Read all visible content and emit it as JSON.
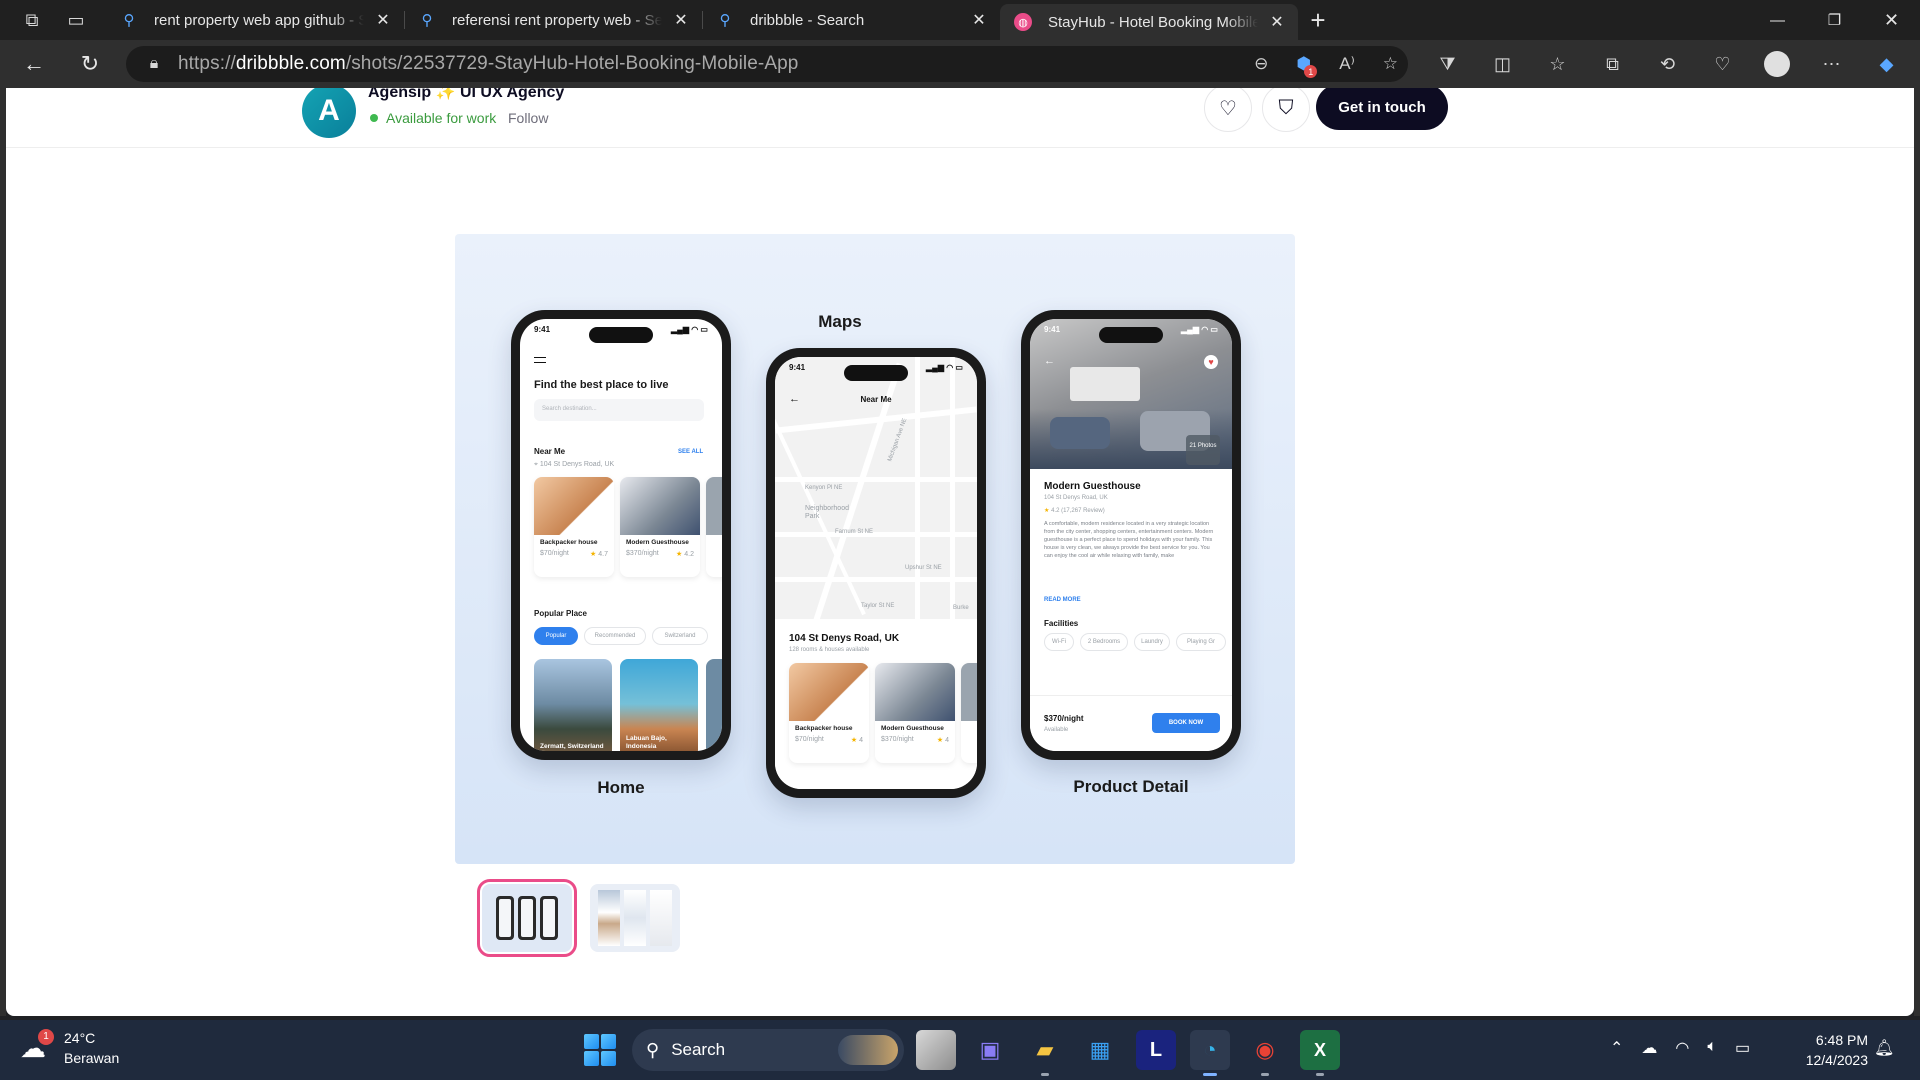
{
  "browser": {
    "tabs": [
      {
        "title": "rent property web app github - S",
        "icon": "search-icon",
        "active": false
      },
      {
        "title": "referensi rent property web - Sea",
        "icon": "search-icon",
        "active": false
      },
      {
        "title": "dribbble - Search",
        "icon": "search-icon",
        "active": false
      },
      {
        "title": "StayHub - Hotel Booking Mobile",
        "icon": "dribbble-icon",
        "active": true
      }
    ],
    "url_prefix": "https://",
    "url_domain": "dribbble.com",
    "url_path": "/shots/22537729-StayHub-Hotel-Booking-Mobile-App",
    "extension_badge": "1"
  },
  "shot": {
    "agency_name": "Agensip",
    "agency_suffix": "UI UX Agency",
    "availability": "Available for work",
    "follow_label": "Follow",
    "cta_label": "Get in touch"
  },
  "mockup": {
    "labels": {
      "home": "Home",
      "maps": "Maps",
      "detail": "Product Detail"
    },
    "status_time": "9:41",
    "home": {
      "title": "Find the best place to live",
      "search_placeholder": "Search destination...",
      "near_me": "Near Me",
      "see_all": "SEE ALL",
      "location": "104 St Denys Road, UK",
      "cards": [
        {
          "name": "Backpacker house",
          "price": "$70/night",
          "rating": "4.7"
        },
        {
          "name": "Modern Guesthouse",
          "price": "$370/night",
          "rating": "4.2"
        }
      ],
      "popular": "Popular Place",
      "chips": [
        "Popular",
        "Recommended",
        "Switzerland"
      ],
      "places": [
        "Zermatt, Switzerland",
        "Labuan Bajo, Indonesia"
      ]
    },
    "maps": {
      "header": "Near Me",
      "address": "104 St Denys Road, UK",
      "subtitle": "128 rooms & houses available",
      "map_labels": [
        "Neighborhood Park",
        "Taylor St NE",
        "Upshur St NE",
        "Farnum St NE",
        "Michigan Ave NE",
        "Kenyon Pl NE",
        "Burke"
      ],
      "cards": [
        {
          "name": "Backpacker house",
          "price": "$70/night",
          "rating": "4"
        },
        {
          "name": "Modern Guesthouse",
          "price": "$370/night",
          "rating": "4"
        }
      ]
    },
    "detail": {
      "photos": "21 Photos",
      "title": "Modern Guesthouse",
      "address": "104 St Denys Road, UK",
      "rating": "4.2 (17,267 Review)",
      "description": "A comfortable, modern residence located in a very strategic location from the city center, shopping centers, entertainment centers. Modern guesthouse is a perfect place to spend holidays with your family. This house is very clean, we always provide the best service for you. You can enjoy the cool air while relaxing with family, make",
      "read_more": "READ MORE",
      "facilities_title": "Facilities",
      "facilities": [
        "Wi-Fi",
        "2 Bedrooms",
        "Laundry",
        "Playing Gr"
      ],
      "price": "$370/night",
      "price_sub": "Available",
      "book": "BOOK NOW"
    }
  },
  "taskbar": {
    "temperature": "24°C",
    "weather": "Berawan",
    "weather_badge": "1",
    "search_label": "Search",
    "time": "6:48 PM",
    "date": "12/4/2023"
  }
}
